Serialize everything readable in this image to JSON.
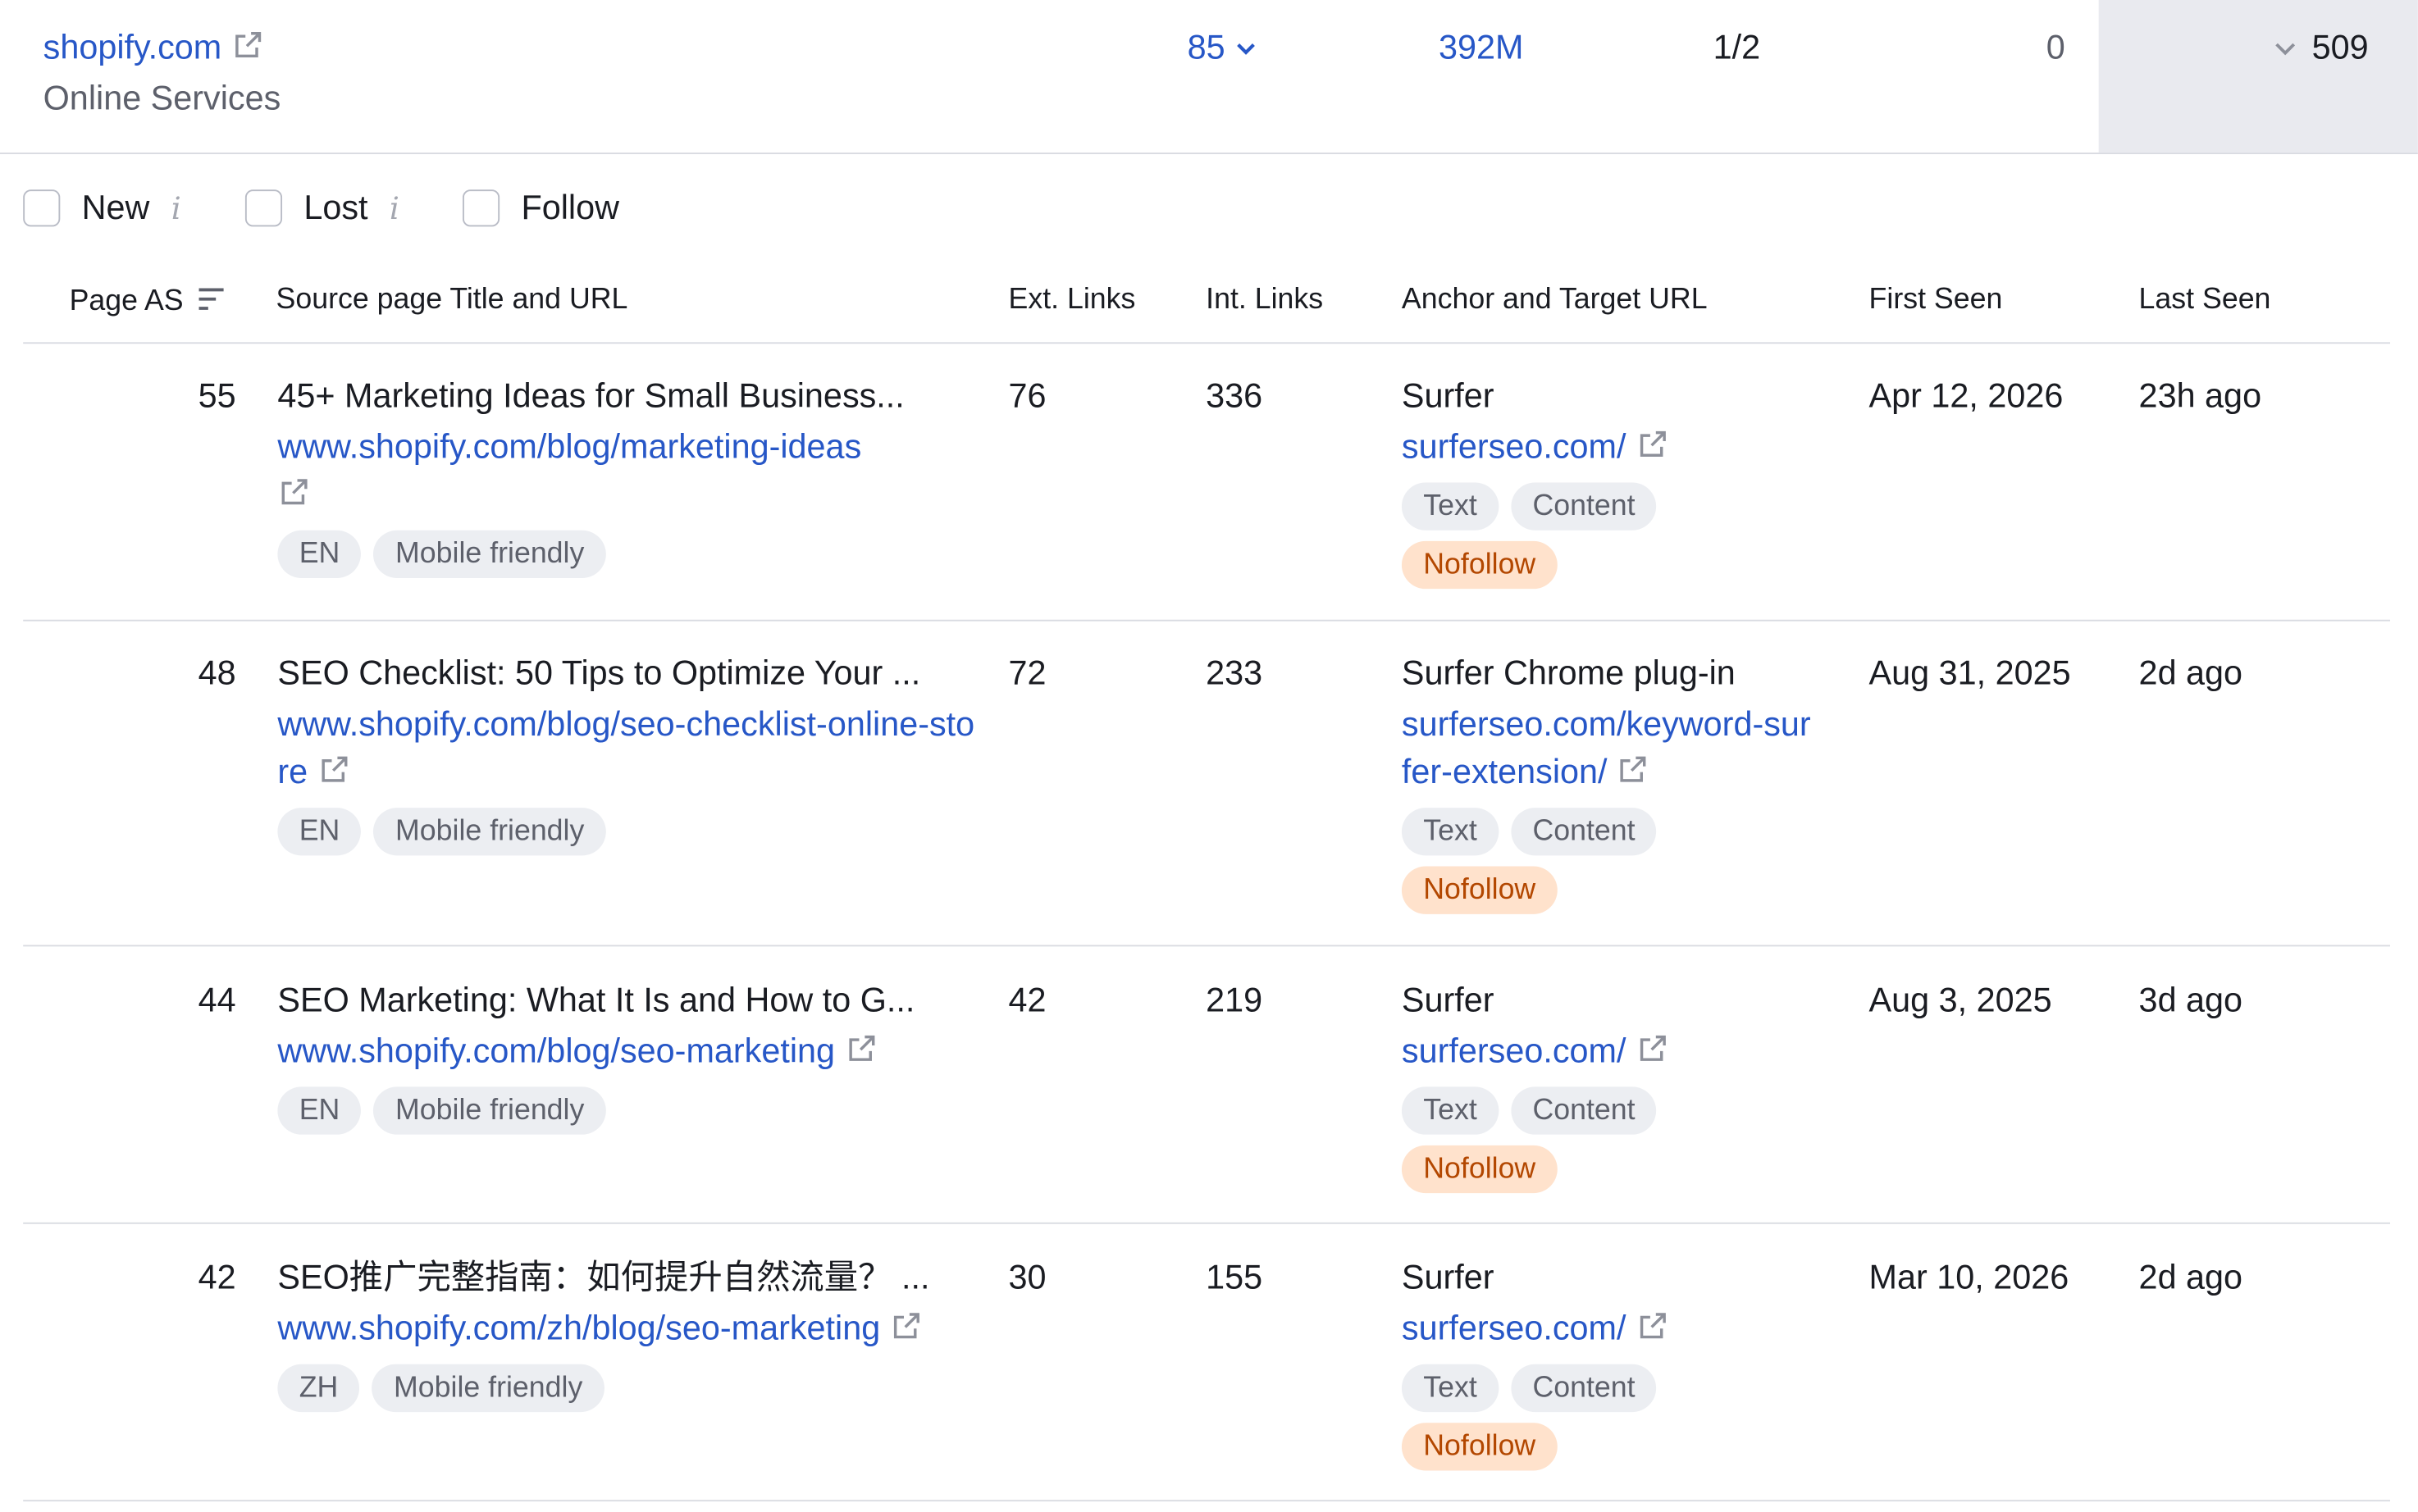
{
  "domain": {
    "name": "shopify.com",
    "category": "Online Services",
    "authority_score": "85",
    "backlinks": "392M",
    "ratio": "1/2",
    "zero_value": "0",
    "count": "509"
  },
  "filters": [
    {
      "label": "New",
      "has_info": true
    },
    {
      "label": "Lost",
      "has_info": true
    },
    {
      "label": "Follow",
      "has_info": false
    }
  ],
  "columns": {
    "page_as": "Page AS",
    "source": "Source page Title and URL",
    "ext_links": "Ext. Links",
    "int_links": "Int. Links",
    "anchor": "Anchor and Target URL",
    "first_seen": "First Seen",
    "last_seen": "Last Seen"
  },
  "rows": [
    {
      "page_as": "55",
      "title": "45+ Marketing Ideas for Small Business...",
      "url": "www.shopify.com/blog/marketing-ideas",
      "lang": "EN",
      "mobile": "Mobile friendly",
      "ext_links": "76",
      "int_links": "336",
      "anchor": "Surfer",
      "target_url": "surferseo.com/",
      "tag_type": "Text",
      "tag_context": "Content",
      "rel": "Nofollow",
      "first_seen": "Apr 12, 2026",
      "last_seen": "23h ago"
    },
    {
      "page_as": "48",
      "title": "SEO Checklist: 50 Tips to Optimize Your ...",
      "url": "www.shopify.com/blog/seo-checklist-online-store",
      "lang": "EN",
      "mobile": "Mobile friendly",
      "ext_links": "72",
      "int_links": "233",
      "anchor": "Surfer Chrome plug-in",
      "target_url": "surferseo.com/keyword-surfer-extension/",
      "tag_type": "Text",
      "tag_context": "Content",
      "rel": "Nofollow",
      "first_seen": "Aug 31, 2025",
      "last_seen": "2d ago"
    },
    {
      "page_as": "44",
      "title": "SEO Marketing: What It Is and How to G...",
      "url": "www.shopify.com/blog/seo-marketing",
      "lang": "EN",
      "mobile": "Mobile friendly",
      "ext_links": "42",
      "int_links": "219",
      "anchor": "Surfer",
      "target_url": "surferseo.com/",
      "tag_type": "Text",
      "tag_context": "Content",
      "rel": "Nofollow",
      "first_seen": "Aug 3, 2025",
      "last_seen": "3d ago"
    },
    {
      "page_as": "42",
      "title": "SEO推广完整指南：如何提升自然流量？ ...",
      "url": "www.shopify.com/zh/blog/seo-marketing",
      "lang": "ZH",
      "mobile": "Mobile friendly",
      "ext_links": "30",
      "int_links": "155",
      "anchor": "Surfer",
      "target_url": "surferseo.com/",
      "tag_type": "Text",
      "tag_context": "Content",
      "rel": "Nofollow",
      "first_seen": "Mar 10, 2026",
      "last_seen": "2d ago"
    }
  ],
  "colors": {
    "link": "#2757c7",
    "nofollow_bg": "#ffe2cc",
    "nofollow_text": "#b34700",
    "tag_bg": "#eceef2",
    "highlight_cell": "#e9eaef"
  }
}
